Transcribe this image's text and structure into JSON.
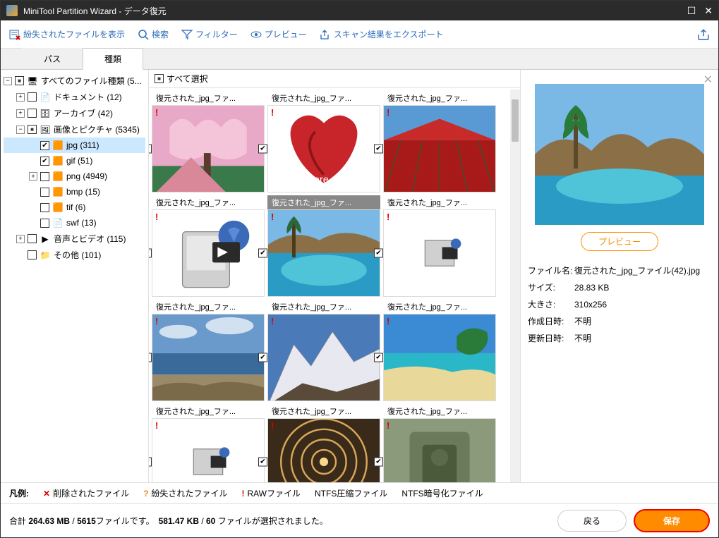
{
  "titlebar": {
    "title": "MiniTool Partition Wizard - データ復元"
  },
  "toolbar": {
    "show_lost": "紛失されたファイルを表示",
    "search": "検索",
    "filter": "フィルター",
    "preview": "プレビュー",
    "export": "スキャン結果をエクスポート"
  },
  "tabs": {
    "path": "パス",
    "type": "種類"
  },
  "tree": {
    "all": "すべてのファイル種類 (5...",
    "documents": "ドキュメント (12)",
    "archive": "アーカイブ (42)",
    "images": "画像とピクチャ (5345)",
    "jpg": "jpg (311)",
    "gif": "gif (51)",
    "png": "png (4949)",
    "bmp": "bmp (15)",
    "tif": "tif (6)",
    "swf": "swf (13)",
    "av": "音声とビデオ (115)",
    "other": "その他 (101)"
  },
  "content": {
    "select_all": "すべて選択",
    "thumbs": [
      {
        "label": "復元された_jpg_ファ...",
        "checked": true,
        "marker": "!",
        "kind": "cherry"
      },
      {
        "label": "復元された_jpg_ファ...",
        "checked": true,
        "marker": "!",
        "kind": "heart"
      },
      {
        "label": "復元された_jpg_ファ...",
        "checked": true,
        "marker": "!",
        "kind": "tulips"
      },
      {
        "label": "復元された_jpg_ファ...",
        "checked": true,
        "marker": "!",
        "kind": "drive"
      },
      {
        "label": "復元された_jpg_ファ...",
        "checked": true,
        "marker": "!",
        "kind": "pool",
        "selected": true
      },
      {
        "label": "復元された_jpg_ファ...",
        "checked": true,
        "marker": "!",
        "kind": "generic"
      },
      {
        "label": "復元された_jpg_ファ...",
        "checked": true,
        "marker": "!",
        "kind": "seaside"
      },
      {
        "label": "復元された_jpg_ファ...",
        "checked": true,
        "marker": "!",
        "kind": "mountain"
      },
      {
        "label": "復元された_jpg_ファ...",
        "checked": true,
        "marker": "!",
        "kind": "beach"
      },
      {
        "label": "復元された_jpg_ファ...",
        "checked": true,
        "marker": "!",
        "kind": "generic"
      },
      {
        "label": "復元された_jpg_ファ...",
        "checked": true,
        "marker": "!",
        "kind": "spiral"
      },
      {
        "label": "復元された_jpg_ファ...",
        "checked": true,
        "marker": "!",
        "kind": "stone"
      }
    ]
  },
  "preview": {
    "button": "プレビュー",
    "labels": {
      "name": "ファイル名:",
      "size": "サイズ:",
      "dim": "大きさ:",
      "created": "作成日時:",
      "modified": "更新日時:"
    },
    "values": {
      "name": "復元された_jpg_ファイル(42).jpg",
      "size": "28.83 KB",
      "dim": "310x256",
      "created": "不明",
      "modified": "不明"
    }
  },
  "legend": {
    "label": "凡例:",
    "deleted": "削除されたファイル",
    "lost": "紛失されたファイル",
    "raw": "RAWファイル",
    "compressed": "NTFS圧縮ファイル",
    "encrypted": "NTFS暗号化ファイル"
  },
  "footer": {
    "total_label": "合計",
    "total_size": "264.63 MB",
    "total_files": "5615",
    "files_suffix": "ファイルです。",
    "sel_size": "581.47 KB",
    "sel_files": "60",
    "selected_suffix": "ファイルが選択されました。",
    "back": "戻る",
    "save": "保存"
  }
}
